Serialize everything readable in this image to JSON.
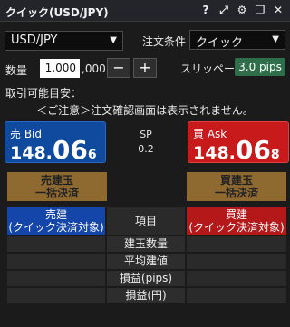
{
  "window": {
    "title": "クイック(USD/JPY)",
    "icons": [
      "help-icon",
      "expand-icon",
      "gear-icon",
      "restore-icon",
      "close-icon"
    ]
  },
  "currency_select": {
    "value": "USD/JPY"
  },
  "order_condition": {
    "label": "注文条件",
    "value": "クイック"
  },
  "quantity": {
    "label": "数量",
    "value": "1,000",
    "suffix": ",000",
    "minus": "−",
    "plus": "+"
  },
  "slippage": {
    "label": "スリッページ",
    "value": "3.0 pips"
  },
  "available": {
    "label": "取引可能目安："
  },
  "notice": "＜ご注意＞注文確認画面は表示されません。",
  "bid": {
    "side": "売 Bid",
    "main": "148.",
    "big": "06",
    "small": "6"
  },
  "ask": {
    "side": "買 Ask",
    "main": "148.",
    "big": "06",
    "small": "8"
  },
  "spread": {
    "label": "SP",
    "value": "0.2"
  },
  "bulk": {
    "sell_l1": "売建玉",
    "sell_l2": "一括決済",
    "buy_l1": "買建玉",
    "buy_l2": "一括決済"
  },
  "table": {
    "sell_l1": "売建",
    "sell_l2": "(クイック決済対象)",
    "mid": "項目",
    "buy_l1": "買建",
    "buy_l2": "(クイック決済対象)",
    "rows": [
      "建玉数量",
      "平均建値",
      "損益(pips)",
      "損益(円)"
    ]
  },
  "colors": {
    "bid": "#0f4a9f",
    "ask": "#c8191b",
    "bulk": "#8f6a30",
    "slippage": "#2f6e4a"
  }
}
